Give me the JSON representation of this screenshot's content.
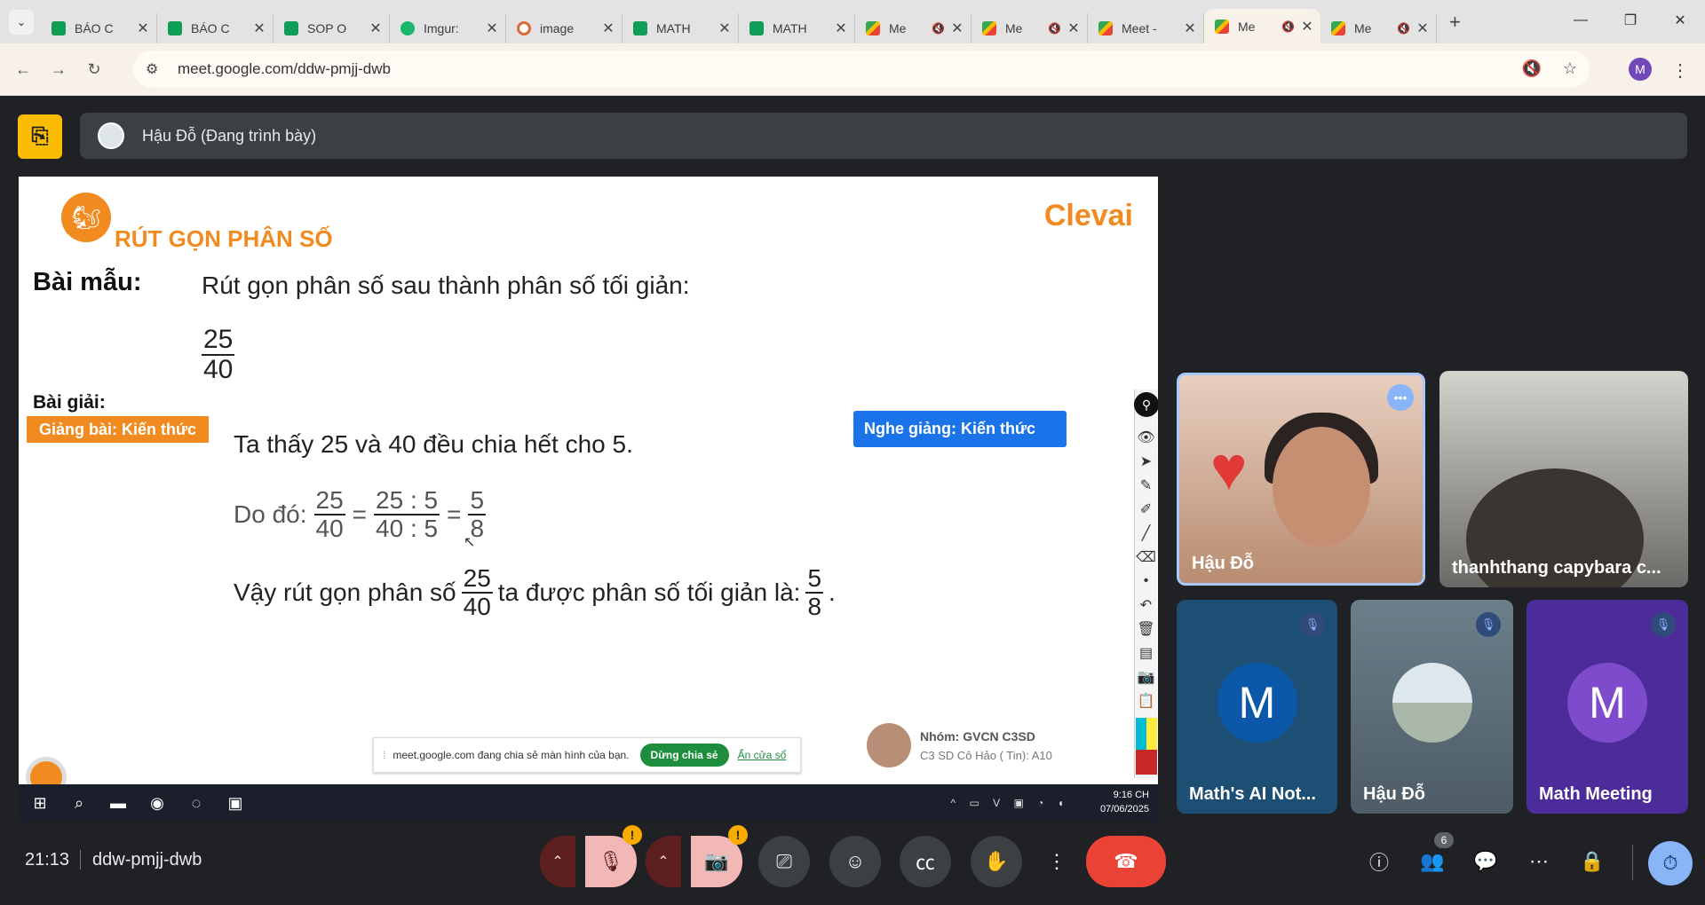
{
  "browser": {
    "tabs": [
      {
        "title": "BÁO C",
        "fav": "sheets"
      },
      {
        "title": "BÁO C",
        "fav": "sheets"
      },
      {
        "title": "SOP O",
        "fav": "sheets"
      },
      {
        "title": "Imgur:",
        "fav": "imgur"
      },
      {
        "title": "image",
        "fav": "image"
      },
      {
        "title": "MATH",
        "fav": "sheets"
      },
      {
        "title": "MATH",
        "fav": "sheets"
      },
      {
        "title": "Me",
        "fav": "meet"
      },
      {
        "title": "Me",
        "fav": "meet"
      },
      {
        "title": "Meet -",
        "fav": "meet"
      },
      {
        "title": "Me",
        "fav": "meet"
      },
      {
        "title": "Me",
        "fav": "meet"
      }
    ],
    "url": "meet.google.com/ddw-pmjj-dwb",
    "profile_initial": "M"
  },
  "presenter": {
    "label": "Hậu Đỗ (Đang trình bày)"
  },
  "slide": {
    "title": "RÚT GỌN PHÂN SỐ",
    "brand": "Clevai",
    "example_label": "Bài mẫu:",
    "question": "Rút gọn phân số sau thành phân số tối giản:",
    "q_num": "25",
    "q_den": "40",
    "solution_label": "Bài giải:",
    "badge_left": "Giảng bài: Kiến thức",
    "badge_right": "Nghe giảng: Kiến thức",
    "line1": "Ta thấy 25 và 40 đều chia hết cho 5.",
    "line2_prefix": "Do đó:",
    "line2_f1n": "25",
    "line2_f1d": "40",
    "line2_eq1": "=",
    "line2_f2n": "25 : 5",
    "line2_f2d": "40 : 5",
    "line2_eq2": "=",
    "line2_f3n": "5",
    "line2_f3d": "8",
    "line3_prefix": "Vậy rút gọn phân số",
    "line3_fn": "25",
    "line3_fd": "40",
    "line3_mid": "ta được phân số tối giản là:",
    "line3_rn": "5",
    "line3_rd": "8",
    "line3_end": ".",
    "share_text": "meet.google.com đang chia sẻ màn hình của bạn.",
    "share_stop": "Dừng chia sẻ",
    "share_hide": "Ẩn cửa sổ",
    "group_name": "Nhóm: GVCN C3SD",
    "group_sub": "C3 SD Cô Hảo ( Tin): A10",
    "taskbar_time": "9:16 CH",
    "taskbar_date": "07/06/2025"
  },
  "participants": [
    {
      "name": "Hậu Đỗ"
    },
    {
      "name": "thanhthang capybara c..."
    },
    {
      "name": "Math's AI Not...",
      "initial": "M"
    },
    {
      "name": "Hậu Đỗ"
    },
    {
      "name": "Math Meeting",
      "initial": "M"
    }
  ],
  "meeting": {
    "time": "21:13",
    "code": "ddw-pmjj-dwb",
    "people_count": "6"
  },
  "colors": {
    "accent": "#f18a1f",
    "meet_bg": "#202124",
    "end_call": "#ea4335",
    "badge_blue": "#1a73e8"
  }
}
